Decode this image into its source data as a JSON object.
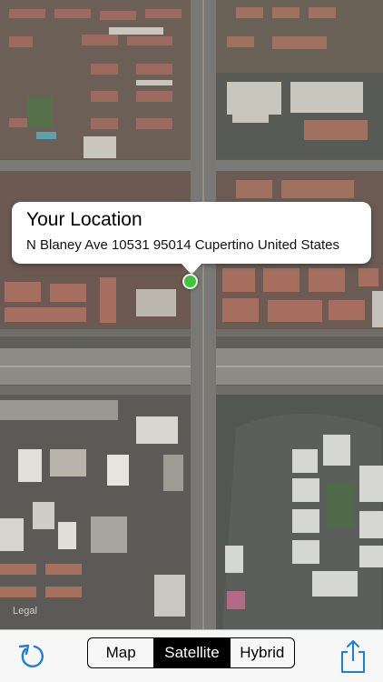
{
  "map": {
    "callout_title": "Your Location",
    "callout_address": "N Blaney Ave 10531 95014 Cupertino United States",
    "legal_label": "Legal",
    "pin_color": "#3fc43c"
  },
  "toolbar": {
    "refresh_icon": "refresh-icon",
    "map_types": [
      "Map",
      "Satellite",
      "Hybrid"
    ],
    "selected_map_type": "Satellite",
    "share_icon": "share-icon",
    "tint_color": "#1a7fe0"
  }
}
